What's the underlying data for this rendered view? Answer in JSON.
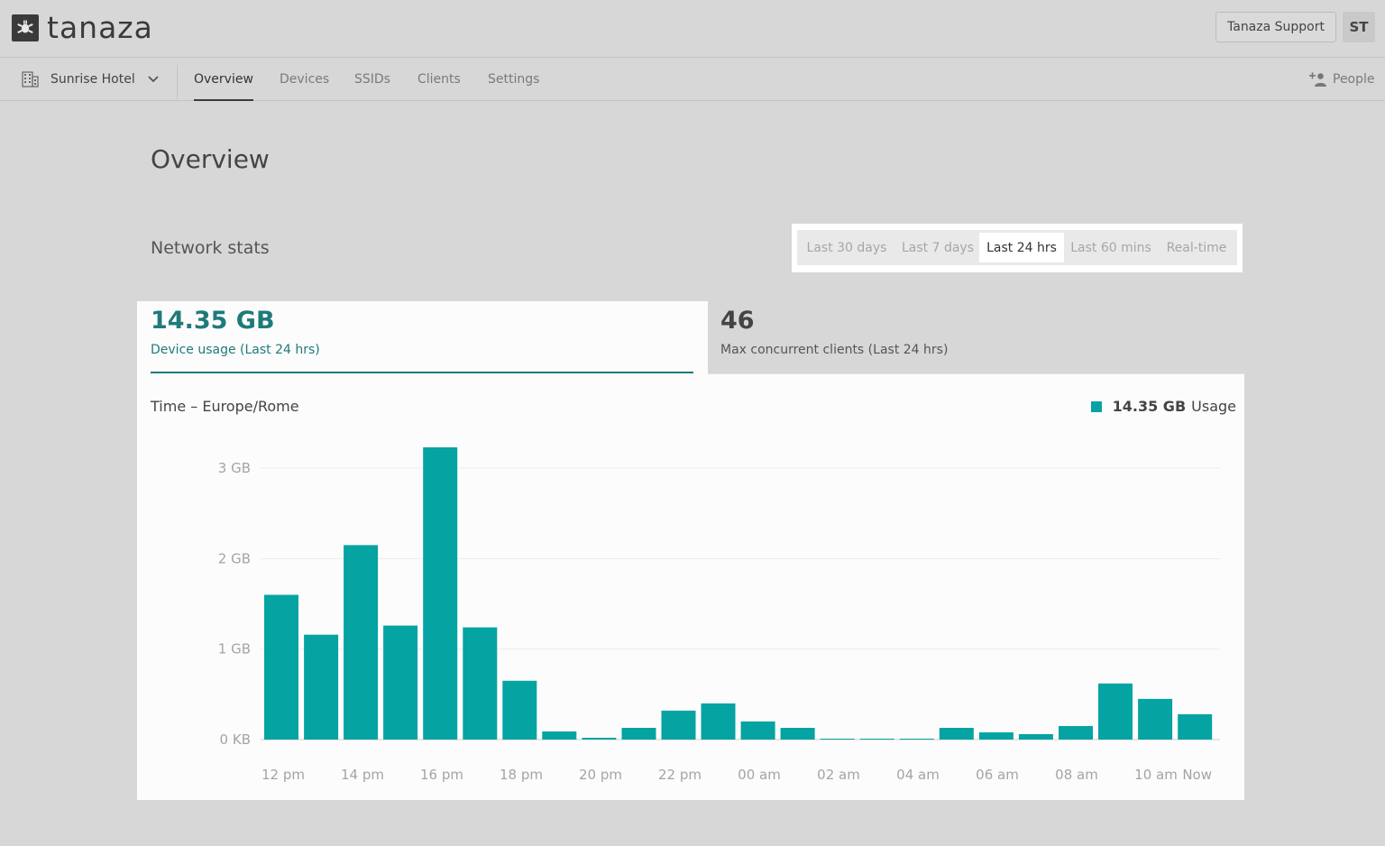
{
  "brand": {
    "name": "tanaza"
  },
  "header": {
    "support_label": "Tanaza Support",
    "avatar_initials": "ST"
  },
  "nav": {
    "site_name": "Sunrise Hotel",
    "tabs": [
      {
        "label": "Overview",
        "active": true
      },
      {
        "label": "Devices",
        "active": false
      },
      {
        "label": "SSIDs",
        "active": false
      },
      {
        "label": "Clients",
        "active": false
      },
      {
        "label": "Settings",
        "active": false
      }
    ],
    "people_label": "People"
  },
  "page": {
    "title": "Overview",
    "section_title": "Network stats"
  },
  "time_ranges": [
    {
      "label": "Last 30 days",
      "active": false
    },
    {
      "label": "Last 7 days",
      "active": false
    },
    {
      "label": "Last 24 hrs",
      "active": true
    },
    {
      "label": "Last 60 mins",
      "active": false
    },
    {
      "label": "Real-time",
      "active": false
    }
  ],
  "stats": {
    "usage": {
      "value": "14.35 GB",
      "label": "Device usage (Last 24 hrs)"
    },
    "clients": {
      "value": "46",
      "label": "Max concurrent clients (Last 24 hrs)"
    }
  },
  "colors": {
    "accent": "#06a3a3",
    "accent_dark": "#1f7a7a"
  },
  "chart_data": {
    "type": "bar",
    "timezone_label": "Time – Europe/Rome",
    "legend": {
      "total": "14.35 GB",
      "name": "Usage"
    },
    "y_unit": "GB",
    "ylim": [
      0,
      3.25
    ],
    "y_ticks": [
      {
        "value": 0,
        "label": "0 KB"
      },
      {
        "value": 1,
        "label": "1 GB"
      },
      {
        "value": 2,
        "label": "2 GB"
      },
      {
        "value": 3,
        "label": "3 GB"
      }
    ],
    "x_tick_labels": [
      "12 pm",
      "14 pm",
      "16 pm",
      "18 pm",
      "20 pm",
      "22 pm",
      "00 am",
      "02 am",
      "04 am",
      "06 am",
      "08 am",
      "10 am",
      "Now"
    ],
    "series": [
      {
        "name": "Usage",
        "values": [
          1.6,
          1.16,
          2.15,
          1.26,
          3.23,
          1.24,
          0.65,
          0.09,
          0.02,
          0.13,
          0.32,
          0.4,
          0.2,
          0.13,
          0.01,
          0.01,
          0.01,
          0.13,
          0.08,
          0.06,
          0.15,
          0.62,
          0.45,
          0.28
        ]
      }
    ],
    "grid": true
  }
}
